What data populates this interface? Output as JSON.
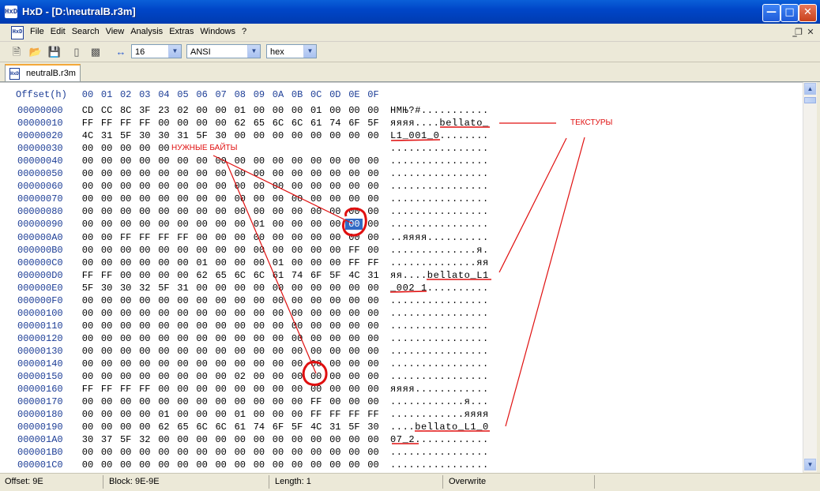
{
  "window": {
    "title": "HxD - [D:\\neutralB.r3m]",
    "app_icon": "HxD"
  },
  "menu": {
    "items": [
      "File",
      "Edit",
      "Search",
      "View",
      "Analysis",
      "Extras",
      "Windows",
      "?"
    ]
  },
  "toolbar": {
    "bytes_per_row": "16",
    "charset": "ANSI",
    "offset_base": "hex"
  },
  "tab": {
    "label": "neutralB.r3m"
  },
  "editor": {
    "header_label": "Offset(h)",
    "columns": [
      "00",
      "01",
      "02",
      "03",
      "04",
      "05",
      "06",
      "07",
      "08",
      "09",
      "0A",
      "0B",
      "0C",
      "0D",
      "0E",
      "0F"
    ],
    "rows": [
      {
        "offset": "00000000",
        "bytes": [
          "CD",
          "CC",
          "8C",
          "3F",
          "23",
          "02",
          "00",
          "00",
          "01",
          "00",
          "00",
          "00",
          "01",
          "00",
          "00",
          "00"
        ],
        "ascii": "НМЊ?#..........."
      },
      {
        "offset": "00000010",
        "bytes": [
          "FF",
          "FF",
          "FF",
          "FF",
          "00",
          "00",
          "00",
          "00",
          "62",
          "65",
          "6C",
          "6C",
          "61",
          "74",
          "6F",
          "5F"
        ],
        "ascii": "яяяя....bellato_"
      },
      {
        "offset": "00000020",
        "bytes": [
          "4C",
          "31",
          "5F",
          "30",
          "30",
          "31",
          "5F",
          "30",
          "00",
          "00",
          "00",
          "00",
          "00",
          "00",
          "00",
          "00"
        ],
        "ascii": "L1_001_0........"
      },
      {
        "offset": "00000030",
        "bytes": [
          "00",
          "00",
          "00",
          "00",
          "00",
          "",
          "",
          "",
          "",
          "",
          "",
          "",
          "",
          "",
          "",
          ""
        ],
        "ascii": "................"
      },
      {
        "offset": "00000040",
        "bytes": [
          "00",
          "00",
          "00",
          "00",
          "00",
          "00",
          "00",
          "00",
          "00",
          "00",
          "00",
          "00",
          "00",
          "00",
          "00",
          "00"
        ],
        "ascii": "................"
      },
      {
        "offset": "00000050",
        "bytes": [
          "00",
          "00",
          "00",
          "00",
          "00",
          "00",
          "00",
          "00",
          "00",
          "00",
          "00",
          "00",
          "00",
          "00",
          "00",
          "00"
        ],
        "ascii": "................"
      },
      {
        "offset": "00000060",
        "bytes": [
          "00",
          "00",
          "00",
          "00",
          "00",
          "00",
          "00",
          "00",
          "00",
          "00",
          "00",
          "00",
          "00",
          "00",
          "00",
          "00"
        ],
        "ascii": "................"
      },
      {
        "offset": "00000070",
        "bytes": [
          "00",
          "00",
          "00",
          "00",
          "00",
          "00",
          "00",
          "00",
          "00",
          "00",
          "00",
          "00",
          "00",
          "00",
          "00",
          "00"
        ],
        "ascii": "................"
      },
      {
        "offset": "00000080",
        "bytes": [
          "00",
          "00",
          "00",
          "00",
          "00",
          "00",
          "00",
          "00",
          "00",
          "00",
          "00",
          "00",
          "00",
          "00",
          "00",
          "00"
        ],
        "ascii": "................"
      },
      {
        "offset": "00000090",
        "bytes": [
          "00",
          "00",
          "00",
          "00",
          "00",
          "00",
          "00",
          "00",
          "00",
          "01",
          "00",
          "00",
          "00",
          "00",
          "00",
          "00"
        ],
        "ascii": "................"
      },
      {
        "offset": "000000A0",
        "bytes": [
          "00",
          "00",
          "FF",
          "FF",
          "FF",
          "FF",
          "00",
          "00",
          "00",
          "00",
          "00",
          "00",
          "00",
          "00",
          "00",
          "00"
        ],
        "ascii": "..яяяя.........."
      },
      {
        "offset": "000000B0",
        "bytes": [
          "00",
          "00",
          "00",
          "00",
          "00",
          "00",
          "00",
          "00",
          "00",
          "00",
          "00",
          "00",
          "00",
          "00",
          "FF",
          "00"
        ],
        "ascii": "..............я."
      },
      {
        "offset": "000000C0",
        "bytes": [
          "00",
          "00",
          "00",
          "00",
          "00",
          "00",
          "01",
          "00",
          "00",
          "00",
          "01",
          "00",
          "00",
          "00",
          "FF",
          "FF"
        ],
        "ascii": "..............яя"
      },
      {
        "offset": "000000D0",
        "bytes": [
          "FF",
          "FF",
          "00",
          "00",
          "00",
          "00",
          "62",
          "65",
          "6C",
          "6C",
          "61",
          "74",
          "6F",
          "5F",
          "4C",
          "31"
        ],
        "ascii": "яя....bellato_L1"
      },
      {
        "offset": "000000E0",
        "bytes": [
          "5F",
          "30",
          "30",
          "32",
          "5F",
          "31",
          "00",
          "00",
          "00",
          "00",
          "00",
          "00",
          "00",
          "00",
          "00",
          "00"
        ],
        "ascii": "_002_1.........."
      },
      {
        "offset": "000000F0",
        "bytes": [
          "00",
          "00",
          "00",
          "00",
          "00",
          "00",
          "00",
          "00",
          "00",
          "00",
          "00",
          "00",
          "00",
          "00",
          "00",
          "00"
        ],
        "ascii": "................"
      },
      {
        "offset": "00000100",
        "bytes": [
          "00",
          "00",
          "00",
          "00",
          "00",
          "00",
          "00",
          "00",
          "00",
          "00",
          "00",
          "00",
          "00",
          "00",
          "00",
          "00"
        ],
        "ascii": "................"
      },
      {
        "offset": "00000110",
        "bytes": [
          "00",
          "00",
          "00",
          "00",
          "00",
          "00",
          "00",
          "00",
          "00",
          "00",
          "00",
          "00",
          "00",
          "00",
          "00",
          "00"
        ],
        "ascii": "................"
      },
      {
        "offset": "00000120",
        "bytes": [
          "00",
          "00",
          "00",
          "00",
          "00",
          "00",
          "00",
          "00",
          "00",
          "00",
          "00",
          "00",
          "00",
          "00",
          "00",
          "00"
        ],
        "ascii": "................"
      },
      {
        "offset": "00000130",
        "bytes": [
          "00",
          "00",
          "00",
          "00",
          "00",
          "00",
          "00",
          "00",
          "00",
          "00",
          "00",
          "00",
          "00",
          "00",
          "00",
          "00"
        ],
        "ascii": "................"
      },
      {
        "offset": "00000140",
        "bytes": [
          "00",
          "00",
          "00",
          "00",
          "00",
          "00",
          "00",
          "00",
          "00",
          "00",
          "00",
          "00",
          "00",
          "00",
          "00",
          "00"
        ],
        "ascii": "................"
      },
      {
        "offset": "00000150",
        "bytes": [
          "00",
          "00",
          "00",
          "00",
          "00",
          "00",
          "00",
          "00",
          "02",
          "00",
          "00",
          "00",
          "00",
          "00",
          "00",
          "00"
        ],
        "ascii": "................"
      },
      {
        "offset": "00000160",
        "bytes": [
          "FF",
          "FF",
          "FF",
          "FF",
          "00",
          "00",
          "00",
          "00",
          "00",
          "00",
          "00",
          "00",
          "00",
          "00",
          "00",
          "00"
        ],
        "ascii": "яяяя............"
      },
      {
        "offset": "00000170",
        "bytes": [
          "00",
          "00",
          "00",
          "00",
          "00",
          "00",
          "00",
          "00",
          "00",
          "00",
          "00",
          "00",
          "FF",
          "00",
          "00",
          "00"
        ],
        "ascii": "............я..."
      },
      {
        "offset": "00000180",
        "bytes": [
          "00",
          "00",
          "00",
          "00",
          "01",
          "00",
          "00",
          "00",
          "01",
          "00",
          "00",
          "00",
          "FF",
          "FF",
          "FF",
          "FF"
        ],
        "ascii": "............яяяя"
      },
      {
        "offset": "00000190",
        "bytes": [
          "00",
          "00",
          "00",
          "00",
          "62",
          "65",
          "6C",
          "6C",
          "61",
          "74",
          "6F",
          "5F",
          "4C",
          "31",
          "5F",
          "30"
        ],
        "ascii": "....bellato_L1_0"
      },
      {
        "offset": "000001A0",
        "bytes": [
          "30",
          "37",
          "5F",
          "32",
          "00",
          "00",
          "00",
          "00",
          "00",
          "00",
          "00",
          "00",
          "00",
          "00",
          "00",
          "00"
        ],
        "ascii": "07_2............"
      },
      {
        "offset": "000001B0",
        "bytes": [
          "00",
          "00",
          "00",
          "00",
          "00",
          "00",
          "00",
          "00",
          "00",
          "00",
          "00",
          "00",
          "00",
          "00",
          "00",
          "00"
        ],
        "ascii": "................"
      },
      {
        "offset": "000001C0",
        "bytes": [
          "00",
          "00",
          "00",
          "00",
          "00",
          "00",
          "00",
          "00",
          "00",
          "00",
          "00",
          "00",
          "00",
          "00",
          "00",
          "00"
        ],
        "ascii": "................"
      }
    ]
  },
  "annotations": {
    "needed_bytes": "НУЖНЫЕ БАЙТЫ",
    "textures": "ТЕКСТУРЫ",
    "color": "#e01010"
  },
  "status": {
    "offset": "Offset: 9E",
    "block": "Block: 9E-9E",
    "length": "Length: 1",
    "mode": "Overwrite"
  }
}
